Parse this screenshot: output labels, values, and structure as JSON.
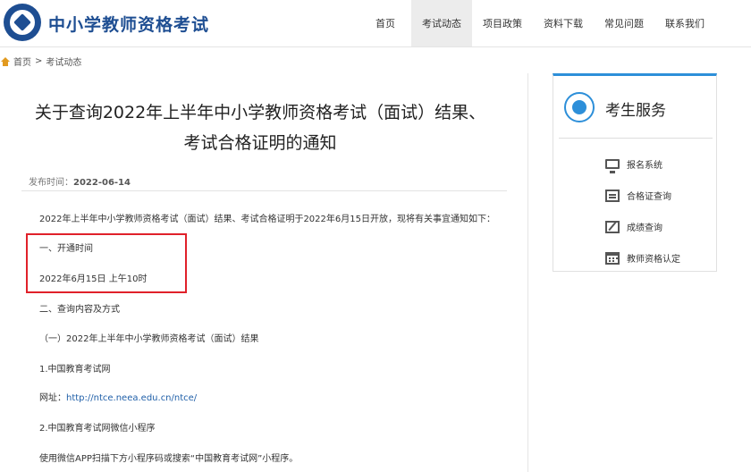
{
  "header": {
    "site_title": "中小学教师资格考试",
    "nav": [
      "首页",
      "考试动态",
      "项目政策",
      "资料下载",
      "常见问题",
      "联系我们"
    ],
    "active_nav": "考试动态"
  },
  "breadcrumb": {
    "home": "首页",
    "separator": ">",
    "current": "考试动态"
  },
  "article": {
    "title_line1": "关于查询2022年上半年中小学教师资格考试（面试）结果、",
    "title_line2": "考试合格证明的通知",
    "publish_label": "发布时间：",
    "publish_date": "2022-06-14",
    "paragraphs": {
      "intro": "2022年上半年中小学教师资格考试（面试）结果、考试合格证明于2022年6月15日开放，现将有关事宜通知如下：",
      "s1_title": "一、开通时间",
      "s1_time": "2022年6月15日 上午10时",
      "s2_title": "二、查询内容及方式",
      "s2_sub1": "（一）2022年上半年中小学教师资格考试（面试）结果",
      "s2_item1": "1.中国教育考试网",
      "url_label": "网址：",
      "url": "http://ntce.neea.edu.cn/ntce/",
      "s2_item2": "2.中国教育考试网微信小程序",
      "s2_item2_desc": "使用微信APP扫描下方小程序码或搜索“中国教育考试网”小程序。"
    }
  },
  "sidebar": {
    "title": "考生服务",
    "items": [
      "报名系统",
      "合格证查询",
      "成绩查询",
      "教师资格认定"
    ],
    "icons": [
      "monitor-icon",
      "card-icon",
      "edit-icon",
      "calendar-icon"
    ]
  },
  "colors": {
    "brand": "#1e4e92",
    "accent": "#2d8fd9",
    "highlight": "#e0212a",
    "link": "#1f5fa8"
  }
}
